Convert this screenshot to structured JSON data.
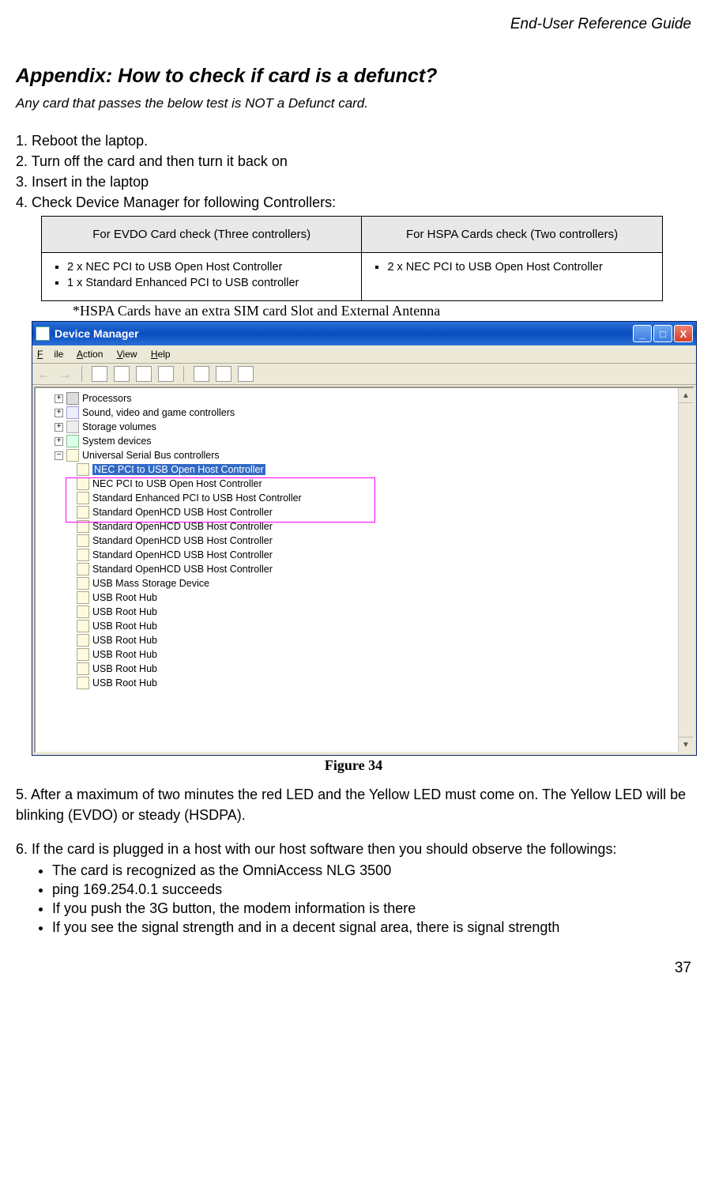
{
  "header": {
    "doc_title": "End-User Reference Guide"
  },
  "appendix": {
    "title": "Appendix: How to check if card is a defunct?",
    "intro": "Any card that passes the below test is NOT a Defunct card."
  },
  "steps": {
    "s1": "1. Reboot the laptop.",
    "s2": "2. Turn off the card and then turn it back on",
    "s3": "3. Insert in the laptop",
    "s4": "4. Check Device Manager for following Controllers:"
  },
  "table": {
    "h1": "For EVDO Card check (Three controllers)",
    "h2": "For HSPA Cards check (Two controllers)",
    "evdo": {
      "i1": "2 x NEC PCI to USB Open Host Controller",
      "i2": "1 x Standard Enhanced PCI to USB controller"
    },
    "hspa": {
      "i1": "2 x NEC PCI to USB Open Host Controller"
    }
  },
  "footnote": "*HSPA Cards have an extra SIM card Slot and External Antenna",
  "dm": {
    "title": "Device Manager",
    "menu": {
      "file": "File",
      "action": "Action",
      "view": "View",
      "help": "Help"
    },
    "tree": {
      "processors": "Processors",
      "sound": "Sound, video and game controllers",
      "storage": "Storage volumes",
      "system": "System devices",
      "usb_root": "Universal Serial Bus controllers",
      "items": [
        "NEC PCI to USB Open Host Controller",
        "NEC PCI to USB Open Host Controller",
        "Standard Enhanced PCI to USB Host Controller",
        "Standard OpenHCD USB Host Controller",
        "Standard OpenHCD USB Host Controller",
        "Standard OpenHCD USB Host Controller",
        "Standard OpenHCD USB Host Controller",
        "Standard OpenHCD USB Host Controller",
        "USB Mass Storage Device",
        "USB Root Hub",
        "USB Root Hub",
        "USB Root Hub",
        "USB Root Hub",
        "USB Root Hub",
        "USB Root Hub",
        "USB Root Hub"
      ]
    }
  },
  "figure_caption": "Figure 34",
  "step5": "5. After a maximum of two minutes the red LED and the Yellow LED must come on. The Yellow LED will be blinking (EVDO) or steady (HSDPA).",
  "step6": "6. If the card is plugged in a host with our host software then you should observe the followings:",
  "observations": {
    "o1": "The card is recognized as the OmniAccess NLG 3500",
    "o2": "ping 169.254.0.1 succeeds",
    "o3": "If you push the 3G button, the modem information is there",
    "o4": "If you see the signal strength and in a decent signal area, there is signal strength"
  },
  "page_number": "37"
}
